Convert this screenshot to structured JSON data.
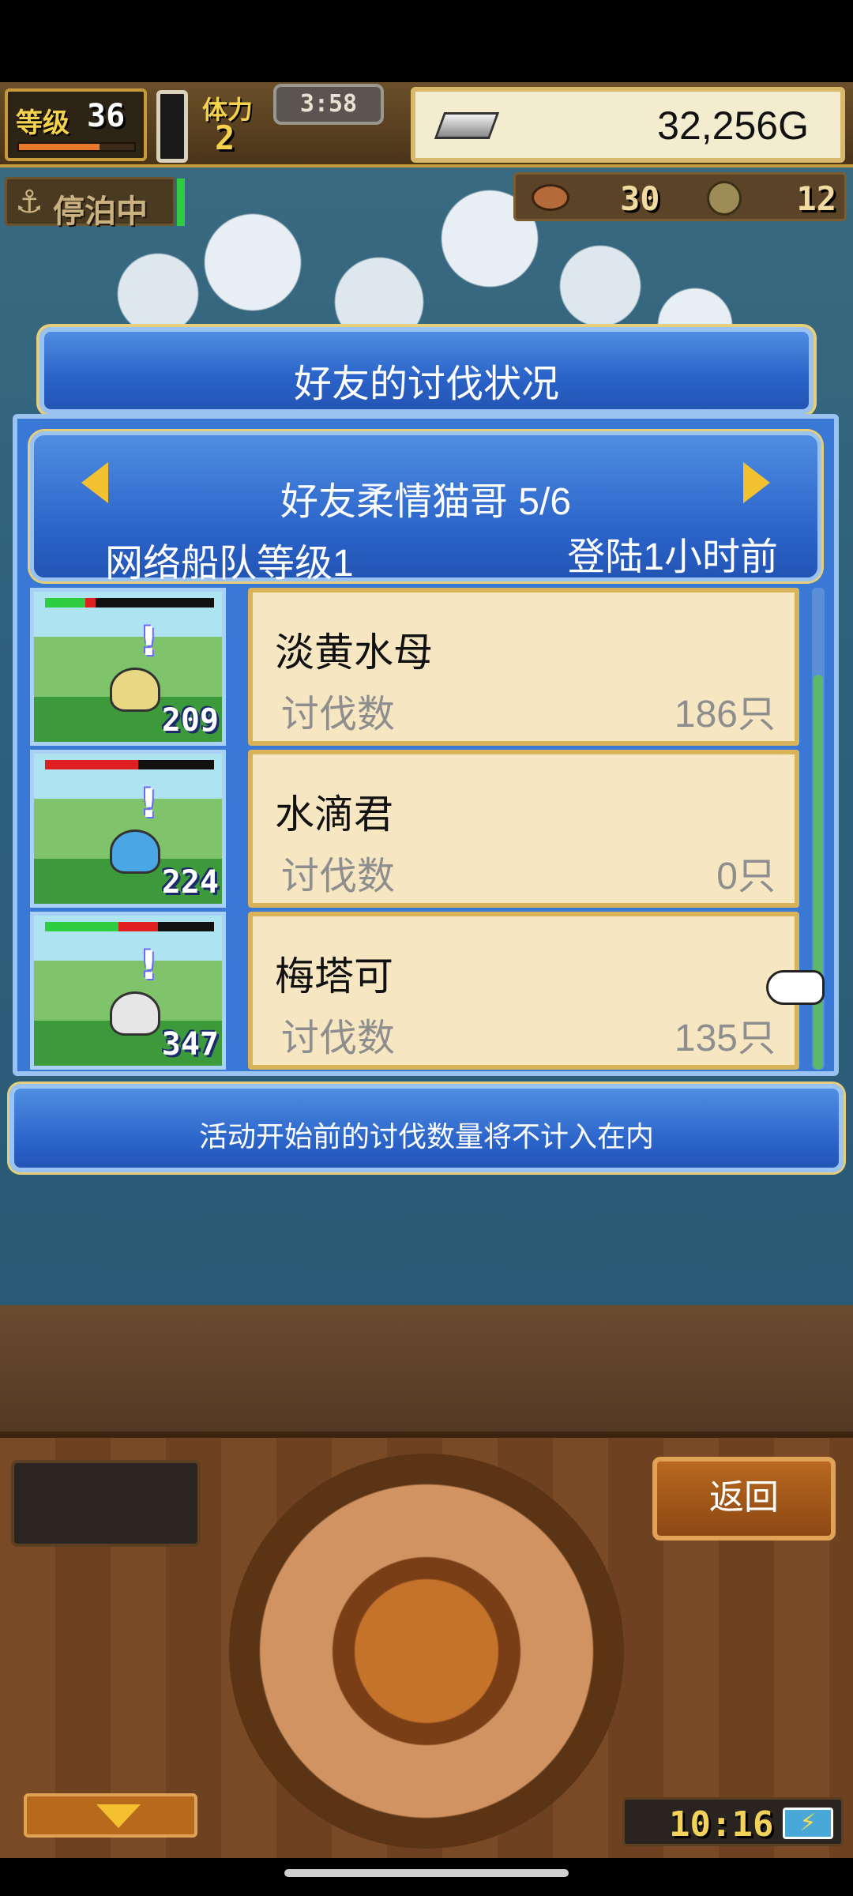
{
  "hud": {
    "level_label": "等级",
    "level": "36",
    "stamina_label": "体力",
    "stamina": "2",
    "timer": "3:58",
    "gold": "32,256G",
    "anchor_status": "停泊中",
    "resource_food": "30",
    "resource_coin": "12"
  },
  "dialog": {
    "title": "好友的讨伐状况",
    "friend_name": "好友柔情猫哥 5/6",
    "fleet_level": "网络船队等级1",
    "last_login": "登陆1小时前",
    "kill_label": "讨伐数",
    "monsters": [
      {
        "name": "淡黄水母",
        "power": "209",
        "kills": "186只",
        "hp_fraction": 0.3,
        "color": "#e8d884"
      },
      {
        "name": "水滴君",
        "power": "224",
        "kills": "0只",
        "hp_fraction": 0.55,
        "color": "#4aa6e4"
      },
      {
        "name": "梅塔可",
        "power": "347",
        "kills": "135只",
        "hp_fraction": 0.67,
        "color": "#e6e6e6"
      }
    ],
    "note": "活动开始前的讨伐数量将不计入在内"
  },
  "console": {
    "back_label": "返回",
    "clock": "10:16"
  },
  "colors": {
    "panel_blue": "#2a62c8",
    "card_cream": "#f6e6c2",
    "hp_green": "#2ecc40",
    "hp_red": "#e02020",
    "gold_yellow": "#f4d34a"
  }
}
